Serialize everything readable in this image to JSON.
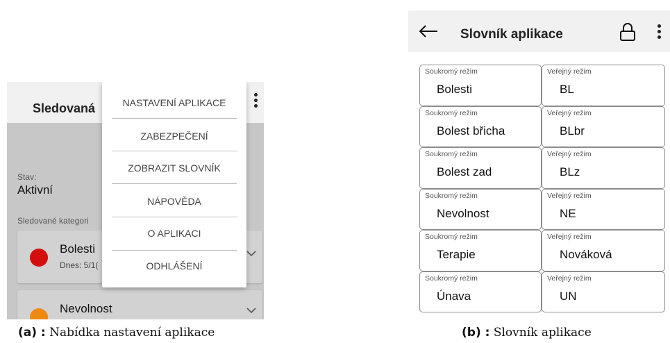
{
  "panel_a": {
    "title": "Sledovaná",
    "stav_label": "Stav:",
    "stav_value": "Aktivní",
    "categories_label": "Sledované kategori",
    "categories": [
      {
        "name": "Bolesti",
        "sub": "Dnes: 5/1(",
        "color": "#d40d0d"
      },
      {
        "name": "Nevolnost",
        "sub": "",
        "color": "#ef8a11"
      }
    ],
    "menu": [
      "NASTAVENÍ APLIKACE",
      "ZABEZPEČENÍ",
      "ZOBRAZIT SLOVNÍK",
      "NÁPOVĚDA",
      "O APLIKACI",
      "ODHLÁŠENÍ"
    ]
  },
  "panel_b": {
    "title": "Slovník aplikace",
    "rows": [
      {
        "private_label": "Soukromý režim",
        "private_value": "Bolesti",
        "public_label": "Veřejný režim",
        "public_value": "BL"
      },
      {
        "private_label": "Soukromý režim",
        "private_value": "Bolest břicha",
        "public_label": "Veřejný režim",
        "public_value": "BLbr"
      },
      {
        "private_label": "Soukromý režim",
        "private_value": "Bolest zad",
        "public_label": "Veřejný režim",
        "public_value": "BLz"
      },
      {
        "private_label": "Soukromý režim",
        "private_value": "Nevolnost",
        "public_label": "Veřejný režim",
        "public_value": "NE"
      },
      {
        "private_label": "Soukromý režim",
        "private_value": "Terapie",
        "public_label": "Veřejný režim",
        "public_value": "Nováková"
      },
      {
        "private_label": "Soukromý režim",
        "private_value": "Únava",
        "public_label": "Veřejný režim",
        "public_value": "UN"
      }
    ]
  },
  "captions": {
    "a_label": "(a) :",
    "a_text": " Nabídka nastavení aplikace",
    "b_label": "(b) :",
    "b_text": " Slovník aplikace"
  }
}
